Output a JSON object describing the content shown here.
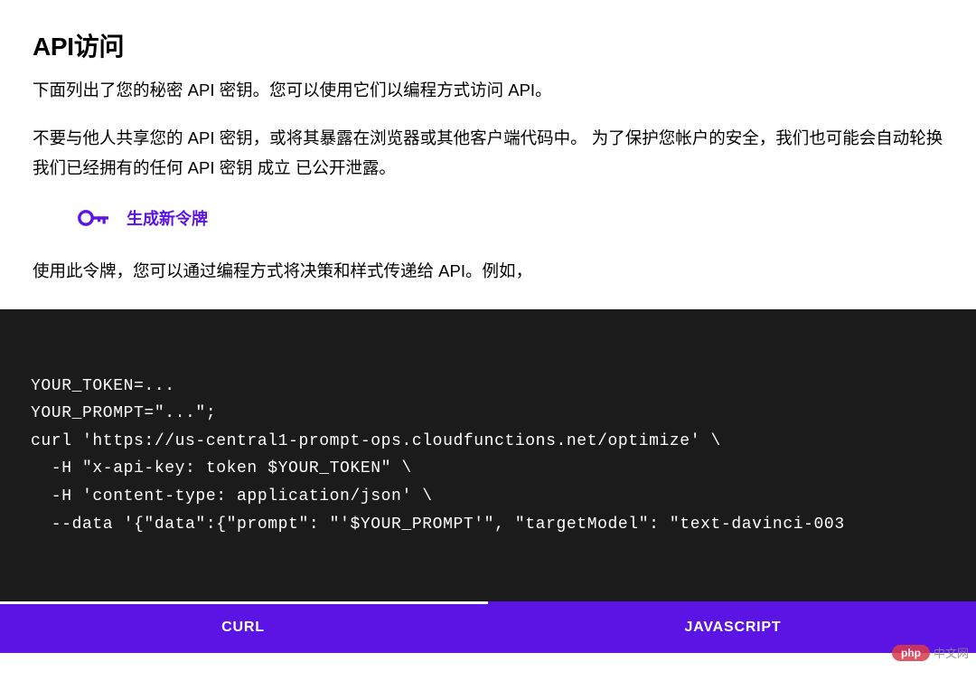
{
  "header": {
    "title": "API访问",
    "description": "下面列出了您的秘密 API 密钥。您可以使用它们以编程方式访问 API。",
    "warning": "不要与他人共享您的 API 密钥，或将其暴露在浏览器或其他客户端代码中。 为了保护您帐户的安全，我们也可能会自动轮换我们已经拥有的任何 API 密钥 成立 已公开泄露。"
  },
  "generate": {
    "label": "生成新令牌"
  },
  "usage": {
    "text": "使用此令牌，您可以通过编程方式将决策和样式传递给 API。例如，"
  },
  "code": {
    "content": "YOUR_TOKEN=...\nYOUR_PROMPT=\"...\";\ncurl 'https://us-central1-prompt-ops.cloudfunctions.net/optimize' \\\n  -H \"x-api-key: token $YOUR_TOKEN\" \\\n  -H 'content-type: application/json' \\\n  --data '{\"data\":{\"prompt\": \"'$YOUR_PROMPT'\", \"targetModel\": \"text-davinci-003"
  },
  "tabs": {
    "items": [
      {
        "label": "CURL",
        "active": true
      },
      {
        "label": "JAVASCRIPT",
        "active": false
      }
    ]
  },
  "watermark": {
    "bubble": "php",
    "text": "中文网"
  },
  "colors": {
    "accent": "#5B14E3",
    "code_bg": "#1B1B1B"
  }
}
